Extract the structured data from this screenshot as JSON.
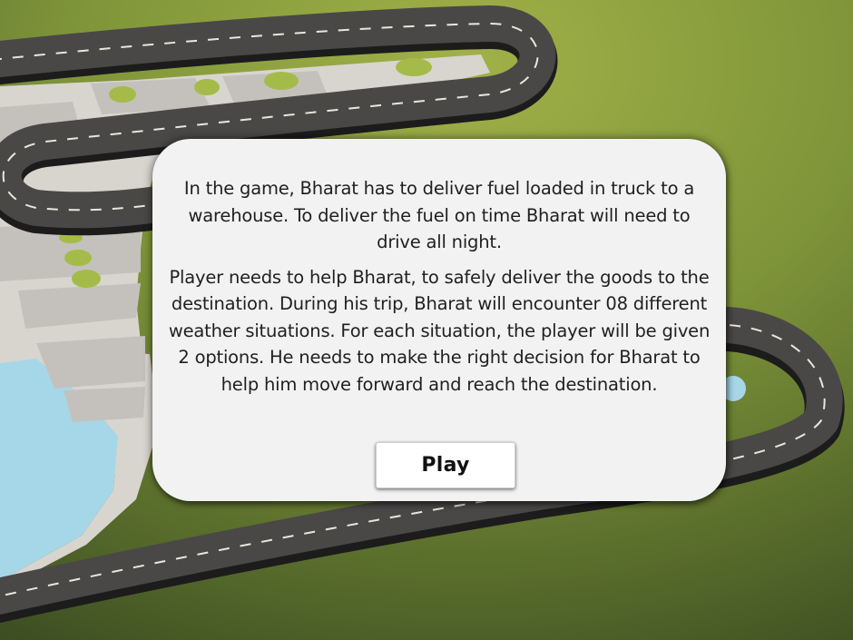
{
  "game": {
    "intro": {
      "paragraph1": "In the game, Bharat has to deliver fuel loaded in truck to a warehouse. To deliver the fuel on time Bharat will need to drive all night.",
      "paragraph2": "Player needs to help Bharat, to safely deliver the goods to the destination. During his trip, Bharat will encounter 08 different weather situations. For each situation, the player will be given 2 options. He needs to make the right decision for Bharat to help him move forward and reach the destination."
    },
    "play_button_label": "Play"
  },
  "colors": {
    "grass_light": "#9aab45",
    "grass_dark": "#3f5224",
    "road": "#4a4846",
    "road_edge": "#1c1c1c",
    "ground": "#d6d3cd",
    "block": "#c3c0bb",
    "water": "#a6d7e8",
    "bush": "#a3ba4a",
    "dialog_bg": "#f2f2f2"
  },
  "icons": {
    "background": "isometric-road-map"
  }
}
